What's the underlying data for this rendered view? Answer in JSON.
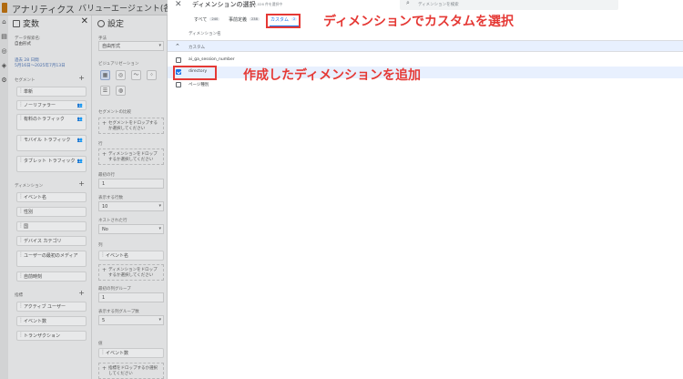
{
  "app": {
    "name": "アナリティクス",
    "property": "バリューエージェント(各種…"
  },
  "rail": {
    "icons": [
      "home-icon",
      "reports-icon",
      "explore-icon",
      "advertising-icon",
      "configure-icon"
    ]
  },
  "variables": {
    "title": "変数",
    "exploration_name_label": "データ探索名:",
    "exploration_name": "自由形式",
    "date_label": "過去 28 日間",
    "date_value": "5月16日～2025年7月13日",
    "segments_label": "セグメント",
    "segments": [
      {
        "label": "単新"
      },
      {
        "label": "ノーリファラー"
      },
      {
        "label": "有料のトラフィック"
      },
      {
        "label": "モバイル トラフィック"
      },
      {
        "label": "タブレット トラフィック"
      }
    ],
    "dimensions_label": "ディメンション",
    "dimensions": [
      {
        "label": "イベント名"
      },
      {
        "label": "性別"
      },
      {
        "label": "国"
      },
      {
        "label": "デバイス カテゴリ"
      },
      {
        "label": "ユーザーの最初のメディア"
      },
      {
        "label": "自前時刻"
      }
    ],
    "metrics_label": "指標",
    "metrics": [
      {
        "label": "アクティブ ユーザー"
      },
      {
        "label": "イベント数"
      },
      {
        "label": "トランザクション"
      }
    ]
  },
  "settings": {
    "title": "設定",
    "technique_label": "手法",
    "technique_value": "自由形式",
    "viz_label": "ビジュアリゼーション",
    "viz_icons": [
      "table-icon",
      "donut-icon",
      "line-icon",
      "scatter-icon",
      "bar-icon",
      "geo-icon"
    ],
    "segment_compare_label": "セグメントの比較",
    "segment_drop": "セグメントをドロップするか選択してください",
    "rows_label": "行",
    "dimension_drop": "ディメンションをドロップするか選択してください",
    "start_row_label": "最初の行",
    "start_row_value": "1",
    "show_rows_label": "表示する行数",
    "show_rows_value": "10",
    "nested_rows_label": "ネストされた行",
    "nested_rows_value": "No",
    "columns_label": "列",
    "column_item": "イベント名",
    "column_drop": "ディメンションをドロップするか選択してください",
    "start_col_label": "最初の列グループ",
    "start_col_value": "1",
    "show_col_label": "表示する列グループ数",
    "show_col_value": "5",
    "values_label": "値",
    "value_item": "イベント数",
    "value_drop": "指標をドロップするか選択してください"
  },
  "modal": {
    "title": "ディメンションの選択",
    "subtitle": "7,026 件を選択中",
    "search_placeholder": "ディメンションを検索",
    "tabs": [
      {
        "label": "すべて",
        "count": "240"
      },
      {
        "label": "事前定義",
        "count": "238"
      },
      {
        "label": "カスタム",
        "count": "2"
      }
    ],
    "active_tab": "カスタム",
    "column_header": "ディメンション名",
    "group_label": "カスタム",
    "rows": [
      {
        "label": "ai_ga_session_number",
        "checked": false
      },
      {
        "label": "directory",
        "checked": true
      },
      {
        "label": "ページ種別",
        "checked": false
      }
    ]
  },
  "annotations": {
    "tab_note": "ディメンションでカスタムを選択",
    "row_note": "作成したディメンションを追加",
    "color": "#e53935"
  }
}
